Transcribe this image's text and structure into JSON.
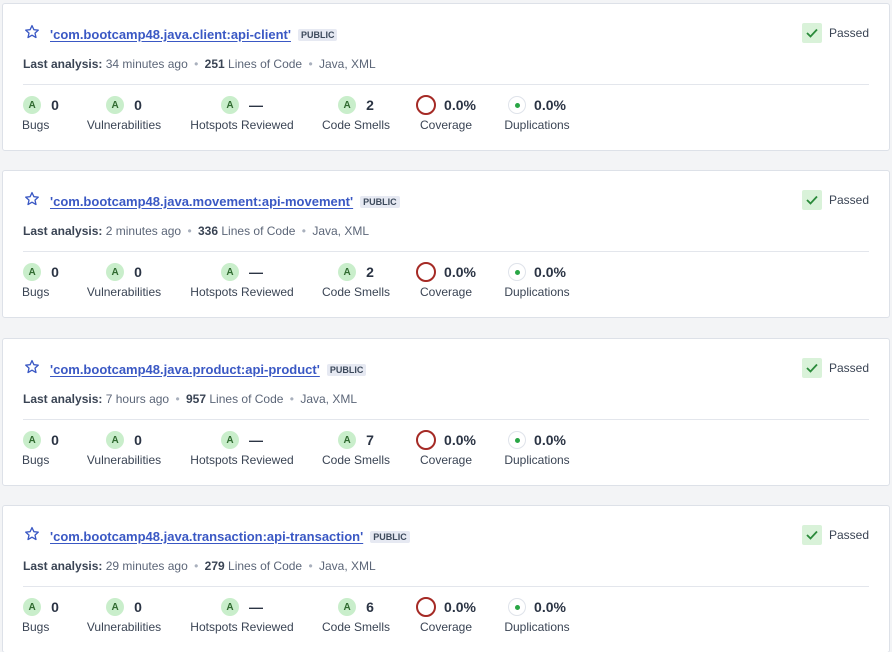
{
  "projects": [
    {
      "name": "'com.bootcamp48.java.client:api-client'",
      "visibility": "PUBLIC",
      "quality_gate": "Passed",
      "last_analysis_label": "Last analysis:",
      "last_analysis": "34 minutes ago",
      "lines_of_code": "251",
      "loc_label": "Lines of Code",
      "languages": "Java, XML",
      "metrics": {
        "bugs": {
          "rating": "A",
          "value": "0",
          "label": "Bugs"
        },
        "vulnerabilities": {
          "rating": "A",
          "value": "0",
          "label": "Vulnerabilities"
        },
        "hotspots": {
          "rating": "A",
          "value": "—",
          "label": "Hotspots Reviewed"
        },
        "code_smells": {
          "rating": "A",
          "value": "2",
          "label": "Code Smells"
        },
        "coverage": {
          "value": "0.0%",
          "label": "Coverage"
        },
        "duplications": {
          "value": "0.0%",
          "label": "Duplications"
        }
      }
    },
    {
      "name": "'com.bootcamp48.java.movement:api-movement'",
      "visibility": "PUBLIC",
      "quality_gate": "Passed",
      "last_analysis_label": "Last analysis:",
      "last_analysis": "2 minutes ago",
      "lines_of_code": "336",
      "loc_label": "Lines of Code",
      "languages": "Java, XML",
      "metrics": {
        "bugs": {
          "rating": "A",
          "value": "0",
          "label": "Bugs"
        },
        "vulnerabilities": {
          "rating": "A",
          "value": "0",
          "label": "Vulnerabilities"
        },
        "hotspots": {
          "rating": "A",
          "value": "—",
          "label": "Hotspots Reviewed"
        },
        "code_smells": {
          "rating": "A",
          "value": "2",
          "label": "Code Smells"
        },
        "coverage": {
          "value": "0.0%",
          "label": "Coverage"
        },
        "duplications": {
          "value": "0.0%",
          "label": "Duplications"
        }
      }
    },
    {
      "name": "'com.bootcamp48.java.product:api-product'",
      "visibility": "PUBLIC",
      "quality_gate": "Passed",
      "last_analysis_label": "Last analysis:",
      "last_analysis": "7 hours ago",
      "lines_of_code": "957",
      "loc_label": "Lines of Code",
      "languages": "Java, XML",
      "metrics": {
        "bugs": {
          "rating": "A",
          "value": "0",
          "label": "Bugs"
        },
        "vulnerabilities": {
          "rating": "A",
          "value": "0",
          "label": "Vulnerabilities"
        },
        "hotspots": {
          "rating": "A",
          "value": "—",
          "label": "Hotspots Reviewed"
        },
        "code_smells": {
          "rating": "A",
          "value": "7",
          "label": "Code Smells"
        },
        "coverage": {
          "value": "0.0%",
          "label": "Coverage"
        },
        "duplications": {
          "value": "0.0%",
          "label": "Duplications"
        }
      }
    },
    {
      "name": "'com.bootcamp48.java.transaction:api-transaction'",
      "visibility": "PUBLIC",
      "quality_gate": "Passed",
      "last_analysis_label": "Last analysis:",
      "last_analysis": "29 minutes ago",
      "lines_of_code": "279",
      "loc_label": "Lines of Code",
      "languages": "Java, XML",
      "metrics": {
        "bugs": {
          "rating": "A",
          "value": "0",
          "label": "Bugs"
        },
        "vulnerabilities": {
          "rating": "A",
          "value": "0",
          "label": "Vulnerabilities"
        },
        "hotspots": {
          "rating": "A",
          "value": "—",
          "label": "Hotspots Reviewed"
        },
        "code_smells": {
          "rating": "A",
          "value": "6",
          "label": "Code Smells"
        },
        "coverage": {
          "value": "0.0%",
          "label": "Coverage"
        },
        "duplications": {
          "value": "0.0%",
          "label": "Duplications"
        }
      }
    }
  ],
  "icons": {
    "favorite": "star-outline-icon",
    "quality_gate": "check-icon",
    "coverage": "coverage-ring-icon",
    "duplications": "duplications-dot-icon"
  },
  "colors": {
    "link": "#3a58c4",
    "rating_a_bg": "#c9eecb",
    "passed_bg": "#d9f2d9",
    "coverage_ring": "#a52a25",
    "duplication_dot": "#29a645"
  }
}
